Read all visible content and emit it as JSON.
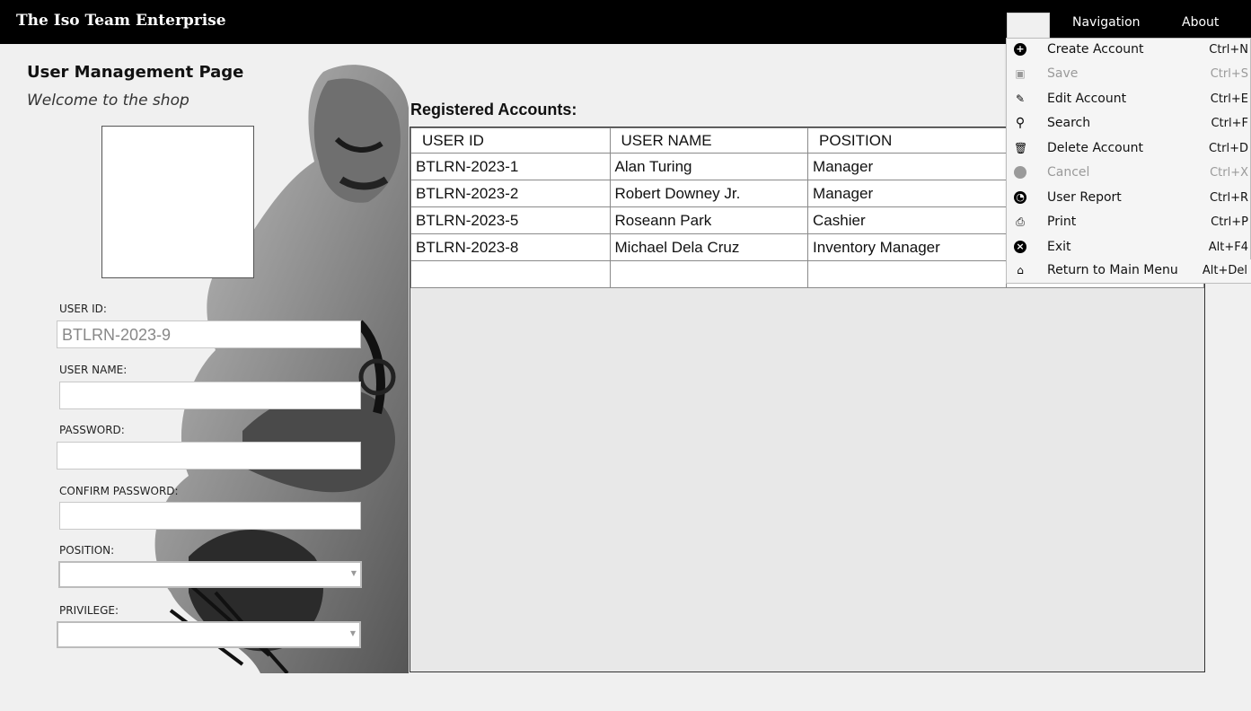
{
  "app": {
    "title": "The Iso Team Enterprise"
  },
  "menubar": {
    "items": [
      "Navigation",
      "About"
    ]
  },
  "page": {
    "title": "User Management Page",
    "welcome": "Welcome to the shop"
  },
  "form": {
    "user_id_label": "USER ID:",
    "user_id_value": "BTLRN-2023-9",
    "user_name_label": "USER NAME:",
    "user_name_value": "",
    "password_label": "PASSWORD:",
    "password_value": "",
    "confirm_password_label": "CONFIRM PASSWORD:",
    "confirm_password_value": "",
    "position_label": "POSITION:",
    "position_value": "",
    "privilege_label": "PRIVILEGE:",
    "privilege_value": ""
  },
  "grid": {
    "title": "Registered Accounts:",
    "columns": [
      "USER ID",
      "USER NAME",
      "POSITION",
      ""
    ],
    "rows": [
      [
        "BTLRN-2023-1",
        "Alan Turing",
        "Manager",
        ""
      ],
      [
        "BTLRN-2023-2",
        "Robert Downey Jr.",
        "Manager",
        ""
      ],
      [
        "BTLRN-2023-5",
        "Roseann Park",
        "Cashier",
        ""
      ],
      [
        "BTLRN-2023-8",
        "Michael Dela Cruz",
        "Inventory Manager",
        ""
      ],
      [
        "",
        "",
        "",
        ""
      ]
    ]
  },
  "dropdown": {
    "items": [
      {
        "label": "Create Account",
        "shortcut": "Ctrl+N",
        "icon": "plus-circle-icon",
        "enabled": true
      },
      {
        "label": "Save",
        "shortcut": "Ctrl+S",
        "icon": "floppy-icon",
        "enabled": false
      },
      {
        "label": "Edit Account",
        "shortcut": "Ctrl+E",
        "icon": "pencil-icon",
        "enabled": true
      },
      {
        "label": "Search",
        "shortcut": "Ctrl+F",
        "icon": "search-icon",
        "enabled": true
      },
      {
        "label": "Delete Account",
        "shortcut": "Ctrl+D",
        "icon": "trash-icon",
        "enabled": true
      },
      {
        "label": "Cancel",
        "shortcut": "Ctrl+X",
        "icon": "minus-circle-icon",
        "enabled": false
      },
      {
        "label": "User Report",
        "shortcut": "Ctrl+R",
        "icon": "report-icon",
        "enabled": true
      },
      {
        "label": "Print",
        "shortcut": "Ctrl+P",
        "icon": "printer-icon",
        "enabled": true
      },
      {
        "label": "Exit",
        "shortcut": "Alt+F4",
        "icon": "close-circle-icon",
        "enabled": true
      },
      {
        "label": "Return to Main Menu",
        "shortcut": "Alt+Del",
        "icon": "home-icon",
        "enabled": true
      }
    ]
  }
}
